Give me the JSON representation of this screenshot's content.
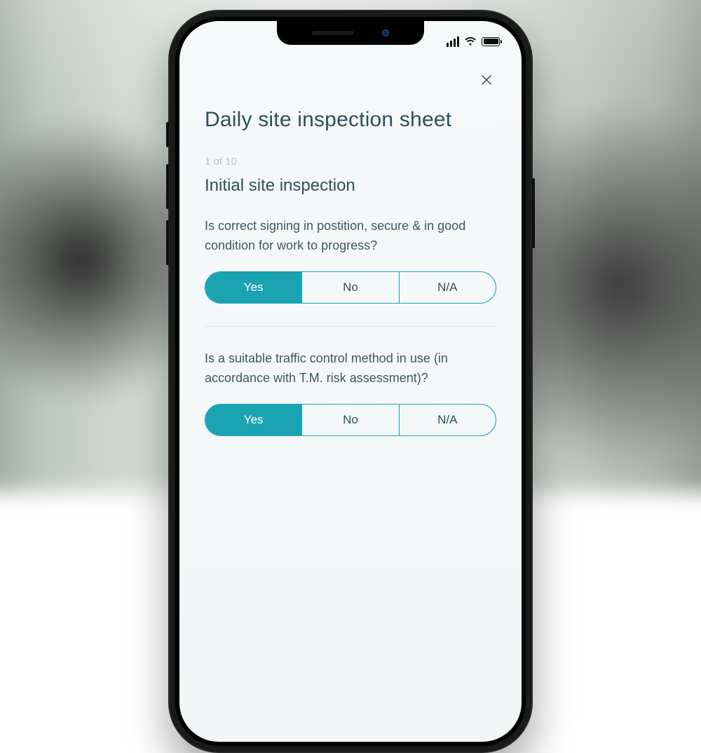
{
  "header": {
    "title": "Daily site inspection sheet",
    "step_counter": "1 of 10",
    "section_title": "Initial site inspection"
  },
  "questions": [
    {
      "text": "Is correct signing in postition, secure & in good condition for work to progress?",
      "options": [
        "Yes",
        "No",
        "N/A"
      ],
      "selected": "Yes"
    },
    {
      "text": "Is a suitable traffic control method in use (in accordance with T.M. risk assessment)?",
      "options": [
        "Yes",
        "No",
        "N/A"
      ],
      "selected": "Yes"
    }
  ],
  "colors": {
    "accent": "#1aa3b0",
    "text_primary": "#2a525a",
    "text_muted": "#b8c3c6"
  }
}
